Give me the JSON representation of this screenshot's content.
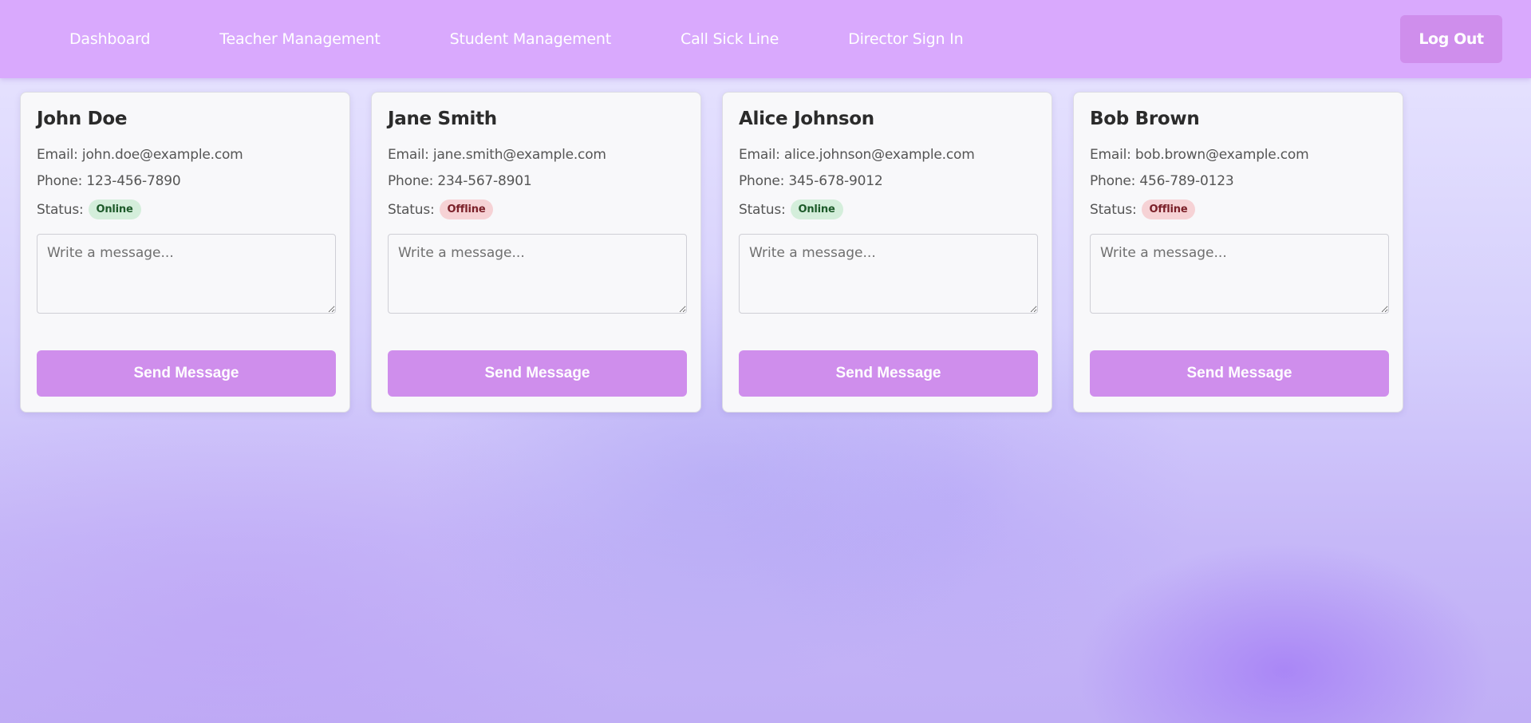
{
  "nav": {
    "links": [
      "Dashboard",
      "Teacher Management",
      "Student Management",
      "Call Sick Line",
      "Director Sign In"
    ],
    "logout_label": "Log Out"
  },
  "labels": {
    "email": "Email:",
    "phone": "Phone:",
    "status": "Status:",
    "placeholder": "Write a message...",
    "send": "Send Message"
  },
  "contacts": [
    {
      "name": "John Doe",
      "email": "john.doe@example.com",
      "phone": "123-456-7890",
      "status": "Online"
    },
    {
      "name": "Jane Smith",
      "email": "jane.smith@example.com",
      "phone": "234-567-8901",
      "status": "Offline"
    },
    {
      "name": "Alice Johnson",
      "email": "alice.johnson@example.com",
      "phone": "345-678-9012",
      "status": "Online"
    },
    {
      "name": "Bob Brown",
      "email": "bob.brown@example.com",
      "phone": "456-789-0123",
      "status": "Offline"
    }
  ],
  "colors": {
    "nav_bg": "#d9a9fd",
    "accent": "#cf8eec",
    "online_bg": "#d4eedb",
    "offline_bg": "#f6d2d5"
  }
}
